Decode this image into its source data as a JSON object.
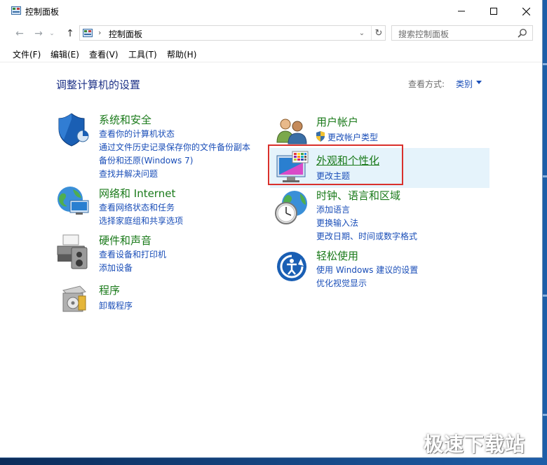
{
  "window": {
    "title": "控制面板",
    "controls": {
      "minimize": "minimize-icon",
      "maximize": "maximize-icon",
      "close": "close-icon"
    }
  },
  "address_bar": {
    "path": "控制面板",
    "separator": "›",
    "search_placeholder": "搜索控制面板"
  },
  "menu": [
    "文件(F)",
    "编辑(E)",
    "查看(V)",
    "工具(T)",
    "帮助(H)"
  ],
  "content": {
    "heading": "调整计算机的设置",
    "view_by_label": "查看方式:",
    "view_by_value": "类别"
  },
  "categories_left": [
    {
      "title": "系统和安全",
      "icon": "shield-icon",
      "links": [
        "查看你的计算机状态",
        "通过文件历史记录保存你的文件备份副本",
        "备份和还原(Windows 7)",
        "查找并解决问题"
      ]
    },
    {
      "title": "网络和 Internet",
      "icon": "network-icon",
      "links": [
        "查看网络状态和任务",
        "选择家庭组和共享选项"
      ]
    },
    {
      "title": "硬件和声音",
      "icon": "printer-icon",
      "links": [
        "查看设备和打印机",
        "添加设备"
      ]
    },
    {
      "title": "程序",
      "icon": "programs-icon",
      "links": [
        "卸载程序"
      ]
    }
  ],
  "categories_right": [
    {
      "title": "用户帐户",
      "icon": "users-icon",
      "links": [
        "更改帐户类型"
      ]
    },
    {
      "title": "外观和个性化",
      "icon": "monitor-palette-icon",
      "links": [
        "更改主题"
      ]
    },
    {
      "title": "时钟、语言和区域",
      "icon": "clock-globe-icon",
      "links": [
        "添加语言",
        "更换输入法",
        "更改日期、时间或数字格式"
      ]
    },
    {
      "title": "轻松使用",
      "icon": "ease-of-access-icon",
      "links": [
        "使用 Windows 建议的设置",
        "优化视觉显示"
      ]
    }
  ],
  "watermark": "极速下载站",
  "colors": {
    "link": "#1a4eb8",
    "category_title": "#1a7a1a",
    "heading": "#1e3287",
    "highlight_border": "#d9302c",
    "hover": "#e5f3fb"
  }
}
